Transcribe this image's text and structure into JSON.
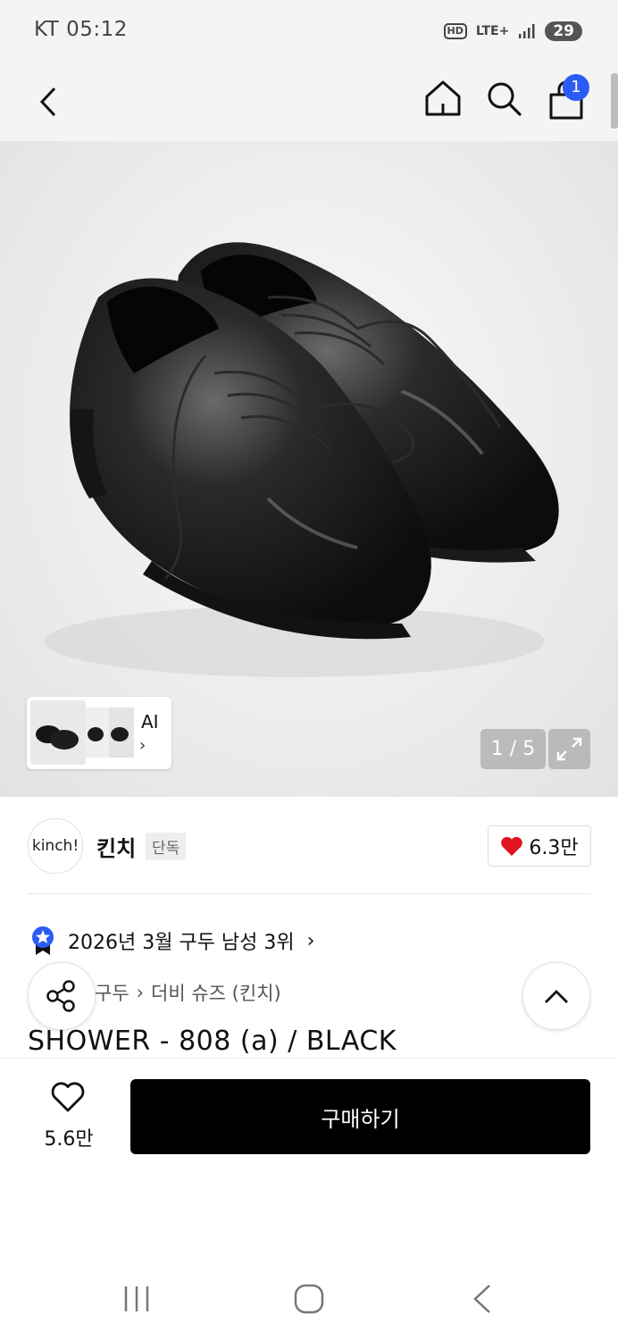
{
  "status_bar": {
    "carrier_time": "KT 05:12",
    "hd": "HD",
    "network": "LTE+",
    "battery": "29"
  },
  "nav": {
    "cart_count": "1"
  },
  "gallery": {
    "counter": "1 / 5",
    "ai_label": "AI",
    "ai_chevron": "›"
  },
  "brand": {
    "logo_text": "kinch!",
    "name": "킨치",
    "badge": "단독",
    "likes": "6.3만"
  },
  "ranking": {
    "text": "2026년 3월 구두 남성 3위",
    "chevron": "›"
  },
  "breadcrumb": {
    "items": [
      "구두",
      "더비 슈즈 (킨치)"
    ],
    "separator": "›"
  },
  "product": {
    "title": "SHOWER - 808 (a) / BLACK"
  },
  "bottom": {
    "wish_count": "5.6만",
    "buy_label": "구매하기"
  },
  "colors": {
    "accent": "#2a5cf5",
    "heart": "#e0141e",
    "buy_bg": "#000000"
  }
}
